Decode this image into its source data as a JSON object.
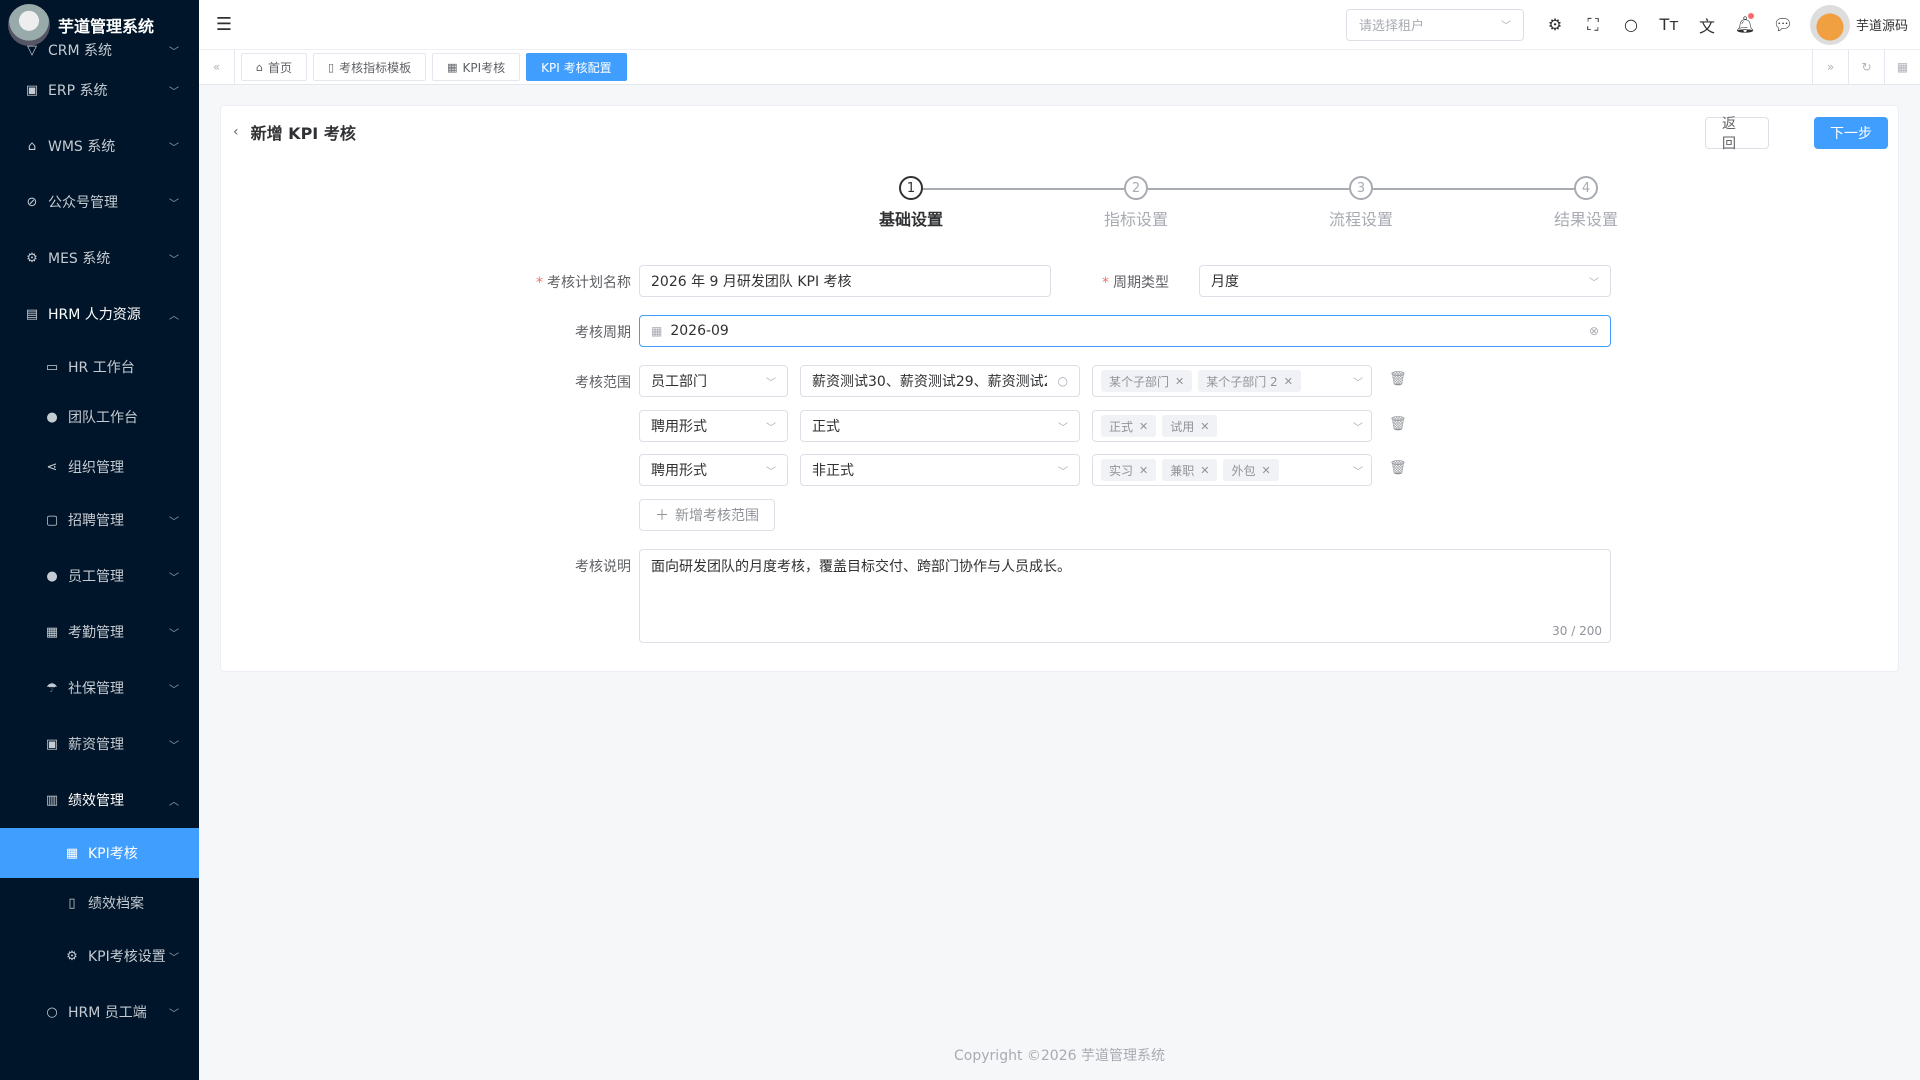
{
  "app": {
    "title": "芋道管理系统"
  },
  "sidebar": {
    "items": [
      {
        "label": "CRM 系统",
        "icon": "shield-icon"
      },
      {
        "label": "ERP 系统",
        "icon": "erp-icon"
      },
      {
        "label": "WMS 系统",
        "icon": "warehouse-icon"
      },
      {
        "label": "公众号管理",
        "icon": "compass-icon"
      },
      {
        "label": "MES 系统",
        "icon": "gear-icon"
      },
      {
        "label": "HRM 人力资源",
        "icon": "building-icon"
      }
    ],
    "hrm_children": [
      {
        "label": "HR 工作台",
        "icon": "desk-icon"
      },
      {
        "label": "团队工作台",
        "icon": "user-icon"
      },
      {
        "label": "组织管理",
        "icon": "share-icon"
      },
      {
        "label": "招聘管理",
        "icon": "briefcase-icon"
      },
      {
        "label": "员工管理",
        "icon": "user-icon"
      },
      {
        "label": "考勤管理",
        "icon": "calendar-icon"
      },
      {
        "label": "社保管理",
        "icon": "umbrella-icon"
      },
      {
        "label": "薪资管理",
        "icon": "money-icon"
      },
      {
        "label": "绩效管理",
        "icon": "chart-icon"
      }
    ],
    "perf_children": [
      {
        "label": "KPI考核",
        "icon": "calendar-icon"
      },
      {
        "label": "绩效档案",
        "icon": "book-icon"
      },
      {
        "label": "KPI考核设置",
        "icon": "gear-icon"
      }
    ],
    "last_item": {
      "label": "HRM 员工端",
      "icon": "user-icon"
    }
  },
  "header": {
    "tenant_placeholder": "请选择租户",
    "username": "芋道源码"
  },
  "tabs": [
    {
      "label": "首页",
      "icon": "home-icon"
    },
    {
      "label": "考核指标模板",
      "icon": "doc-icon"
    },
    {
      "label": "KPI考核",
      "icon": "calendar-icon"
    },
    {
      "label": "KPI 考核配置",
      "icon": ""
    }
  ],
  "page": {
    "title": "新增 KPI 考核",
    "back_label": "返 回",
    "next_label": "下一步"
  },
  "steps": [
    {
      "num": "1",
      "label": "基础设置"
    },
    {
      "num": "2",
      "label": "指标设置"
    },
    {
      "num": "3",
      "label": "流程设置"
    },
    {
      "num": "4",
      "label": "结果设置"
    }
  ],
  "form": {
    "plan_name_label": "考核计划名称",
    "plan_name_value": "2026 年 9 月研发团队 KPI 考核",
    "cycle_type_label": "周期类型",
    "cycle_type_value": "月度",
    "period_label": "考核周期",
    "period_value": "2026-09",
    "scope_label": "考核范围",
    "scope_rows": [
      {
        "type": "员工部门",
        "value": "薪资测试30、薪资测试29、薪资测试2",
        "tags": [
          "某个子部门",
          "某个子部门 2"
        ]
      },
      {
        "type": "聘用形式",
        "value": "正式",
        "tags": [
          "正式",
          "试用"
        ]
      },
      {
        "type": "聘用形式",
        "value": "非正式",
        "tags": [
          "实习",
          "兼职",
          "外包"
        ]
      }
    ],
    "add_scope_label": "新增考核范围",
    "desc_label": "考核说明",
    "desc_value": "面向研发团队的月度考核，覆盖目标交付、跨部门协作与人员成长。",
    "desc_counter": "30 / 200"
  },
  "footer": {
    "text": "Copyright ©2026 芋道管理系统"
  }
}
